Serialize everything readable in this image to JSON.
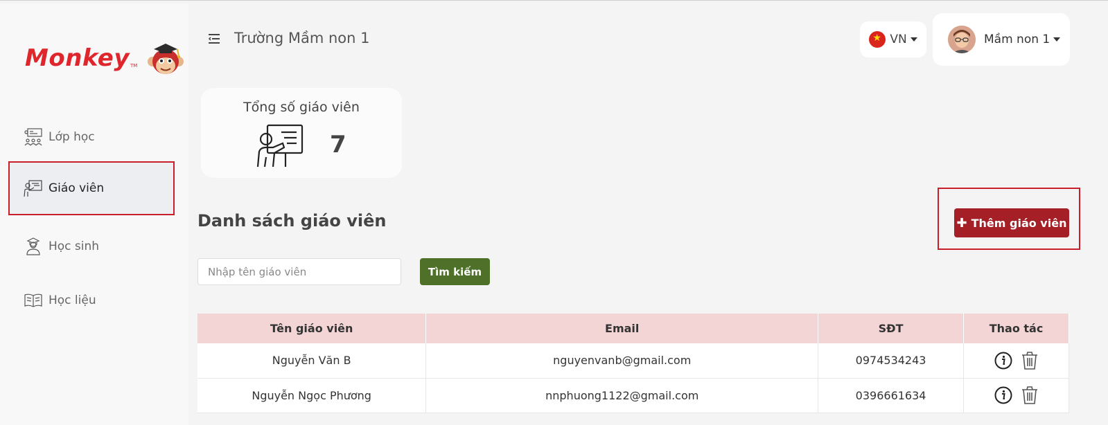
{
  "sidebar": {
    "logo_text": "Monkey",
    "logo_tm": "TM",
    "items": [
      {
        "label": "Lớp học",
        "icon": "classroom-icon"
      },
      {
        "label": "Giáo viên",
        "icon": "teacher-icon",
        "active": true
      },
      {
        "label": "Học sinh",
        "icon": "student-icon"
      },
      {
        "label": "Học liệu",
        "icon": "book-icon"
      }
    ]
  },
  "header": {
    "school_name": "Trường Mầm non 1",
    "language": "VN",
    "user_name": "Mầm non 1"
  },
  "stat": {
    "title": "Tổng số giáo viên",
    "value": "7"
  },
  "list": {
    "title": "Danh sách giáo viên",
    "add_button": "Thêm giáo viên",
    "search_placeholder": "Nhập tên giáo viên",
    "search_button": "Tìm kiếm",
    "columns": [
      "Tên giáo viên",
      "Email",
      "SĐT",
      "Thao tác"
    ],
    "rows": [
      {
        "name": "Nguyễn Văn B",
        "email": "nguyenvanb@gmail.com",
        "phone": "0974534243"
      },
      {
        "name": "Nguyễn Ngọc Phương",
        "email": "nnphuong1122@gmail.com",
        "phone": "0396661634"
      }
    ]
  },
  "colors": {
    "brand_red": "#e0262d",
    "add_button": "#a51f26",
    "search_button": "#4e7028",
    "table_header": "#f3d5d6",
    "highlight_border": "#c81e2a"
  }
}
